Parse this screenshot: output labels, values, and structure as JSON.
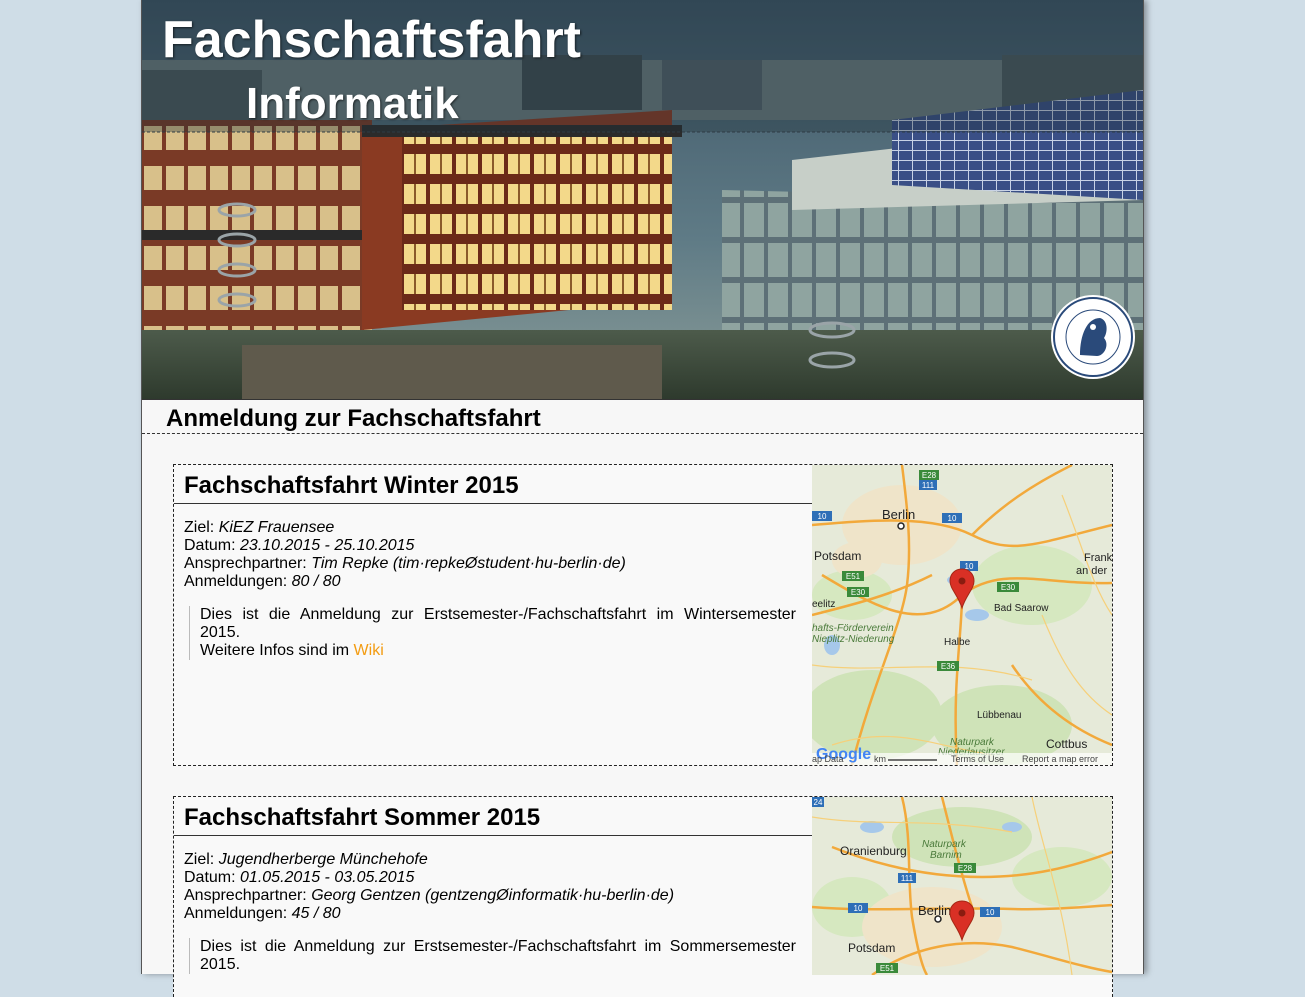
{
  "header": {
    "title": "Fachschaftsfahrt",
    "subtitle": "Informatik",
    "seal_text": "HUMBOLDT-UNIVERSITÄT ZU BERLIN"
  },
  "page_heading": "Anmeldung zur Fachschaftsfahrt",
  "trips": [
    {
      "title": "Fachschaftsfahrt Winter 2015",
      "ziel_label": "Ziel:",
      "ziel": "KiEZ Frauensee",
      "datum_label": "Datum:",
      "datum": "23.10.2015 - 25.10.2015",
      "contact_label": "Ansprechpartner:",
      "contact": "Tim Repke (tim·repkeØstudent·hu-berlin·de)",
      "registrations_label": "Anmeldungen:",
      "registrations": "80 / 80",
      "description_line1": "Dies ist die Anmeldung zur Erstsemester-/Fachschaftsfahrt im Wintersemester 2015.",
      "description_line2": "Weitere Infos sind im",
      "wiki_link": "Wiki",
      "map_labels": {
        "berlin": "Berlin",
        "potsdam": "Potsdam",
        "frank": "Frank",
        "an_der": "an der",
        "bad_saarow": "Bad Saarow",
        "beelitz": "eelitz",
        "foerderverein": "hafts-Förderverein",
        "nieplitz": "Nieplitz-Niederung",
        "halbe": "Halbe",
        "luebbenau": "Lübbenau",
        "cottbus": "Cottbus",
        "naturpark": "Naturpark",
        "niederlausitzer": "Niederlausitzer",
        "map_data": "ap Data",
        "km": "km",
        "terms": "Terms of Use",
        "report": "Report a map error",
        "google": "Google",
        "road_e28": "E28",
        "road_111": "111",
        "road_10": "10",
        "road_e51": "E51",
        "road_e30": "E30",
        "road_e36": "E36"
      }
    },
    {
      "title": "Fachschaftsfahrt Sommer 2015",
      "ziel_label": "Ziel:",
      "ziel": "Jugendherberge Münchehofe",
      "datum_label": "Datum:",
      "datum": "01.05.2015 - 03.05.2015",
      "contact_label": "Ansprechpartner:",
      "contact": "Georg Gentzen (gentzengØinformatik·hu-berlin·de)",
      "registrations_label": "Anmeldungen:",
      "registrations": "45 / 80",
      "description_line1": "Dies ist die Anmeldung zur Erstsemester-/Fachschaftsfahrt im Sommersemester 2015.",
      "map_labels": {
        "oranienburg": "Oranienburg",
        "naturpark": "Naturpark",
        "barnim": "Barnim",
        "berlin": "Berlin",
        "potsdam": "Potsdam",
        "road_e28": "E28",
        "road_111": "111",
        "road_10": "10",
        "road_e51": "E51",
        "road_24": "24"
      }
    }
  ],
  "colors": {
    "page_bg": "#cfdde7",
    "content_bg": "#f7f7f7",
    "link": "#f39c12",
    "marker": "#d93025"
  }
}
